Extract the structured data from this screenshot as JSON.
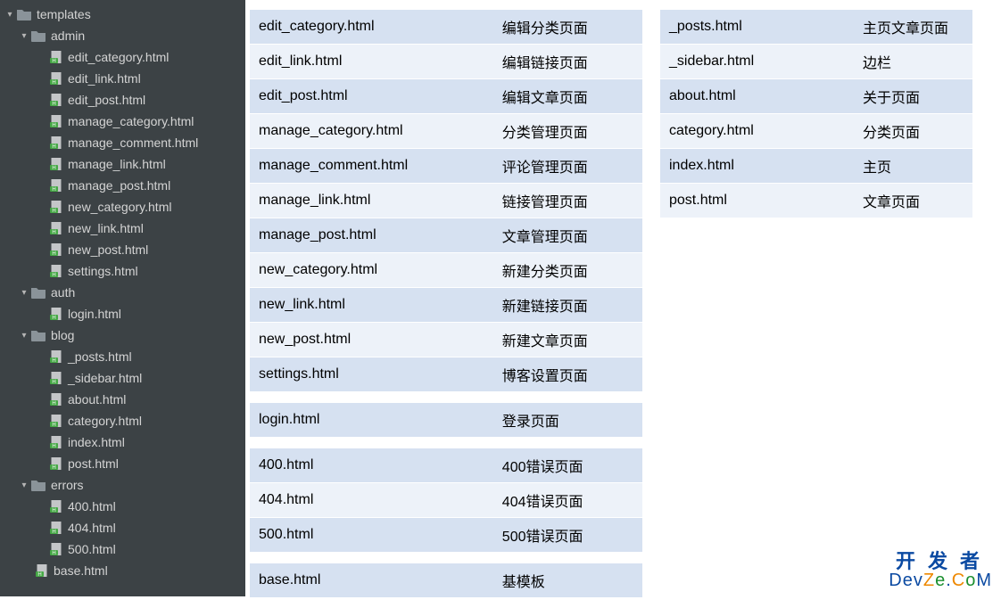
{
  "tree": {
    "templates": {
      "label": "templates",
      "admin": {
        "label": "admin",
        "files": [
          "edit_category.html",
          "edit_link.html",
          "edit_post.html",
          "manage_category.html",
          "manage_comment.html",
          "manage_link.html",
          "manage_post.html",
          "new_category.html",
          "new_link.html",
          "new_post.html",
          "settings.html"
        ]
      },
      "auth": {
        "label": "auth",
        "files": [
          "login.html"
        ]
      },
      "blog": {
        "label": "blog",
        "files": [
          "_posts.html",
          "_sidebar.html",
          "about.html",
          "category.html",
          "index.html",
          "post.html"
        ]
      },
      "errors": {
        "label": "errors",
        "files": [
          "400.html",
          "404.html",
          "500.html"
        ]
      },
      "base_file": "base.html"
    }
  },
  "tables": {
    "admin": [
      {
        "file": "edit_category.html",
        "desc": "编辑分类页面"
      },
      {
        "file": "edit_link.html",
        "desc": "编辑链接页面"
      },
      {
        "file": "edit_post.html",
        "desc": "编辑文章页面"
      },
      {
        "file": "manage_category.html",
        "desc": "分类管理页面"
      },
      {
        "file": "manage_comment.html",
        "desc": "评论管理页面"
      },
      {
        "file": "manage_link.html",
        "desc": "链接管理页面"
      },
      {
        "file": "manage_post.html",
        "desc": "文章管理页面"
      },
      {
        "file": "new_category.html",
        "desc": "新建分类页面"
      },
      {
        "file": "new_link.html",
        "desc": "新建链接页面"
      },
      {
        "file": "new_post.html",
        "desc": "新建文章页面"
      },
      {
        "file": "settings.html",
        "desc": "博客设置页面"
      }
    ],
    "auth": [
      {
        "file": "login.html",
        "desc": "登录页面"
      }
    ],
    "errors": [
      {
        "file": "400.html",
        "desc": "400错误页面"
      },
      {
        "file": "404.html",
        "desc": "404错误页面"
      },
      {
        "file": "500.html",
        "desc": "500错误页面"
      }
    ],
    "base": [
      {
        "file": "base.html",
        "desc": "基模板"
      }
    ],
    "blog": [
      {
        "file": "_posts.html",
        "desc": "主页文章页面"
      },
      {
        "file": "_sidebar.html",
        "desc": "边栏"
      },
      {
        "file": "about.html",
        "desc": "关于页面"
      },
      {
        "file": "category.html",
        "desc": "分类页面"
      },
      {
        "file": "index.html",
        "desc": "主页"
      },
      {
        "file": "post.html",
        "desc": "文章页面"
      }
    ]
  },
  "watermark": {
    "cn": "开发者",
    "dev": "Dev",
    "z": "Z",
    "e": "e",
    "dot": ".",
    "c": "C",
    "o": "o",
    "m": "M"
  }
}
